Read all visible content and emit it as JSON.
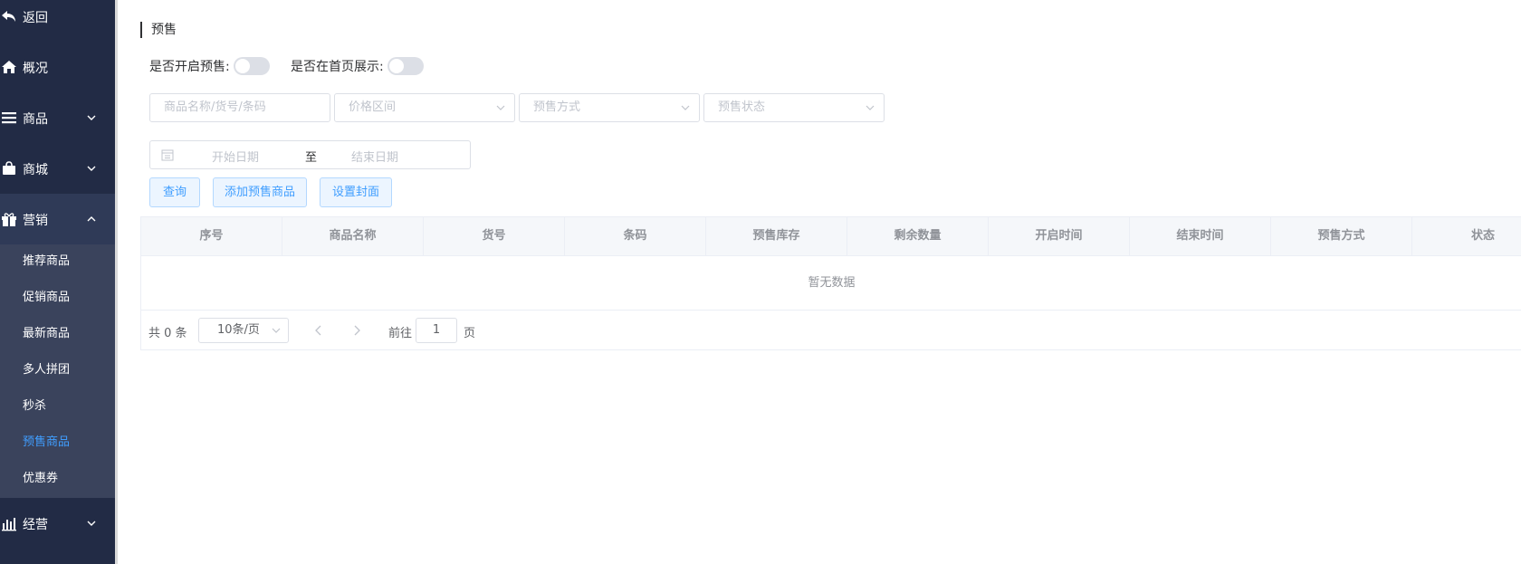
{
  "sidebar": {
    "items": [
      {
        "label": "返回",
        "icon": "back-arrow-icon"
      },
      {
        "label": "概况",
        "icon": "home-icon"
      },
      {
        "label": "商品",
        "icon": "list-icon"
      },
      {
        "label": "商城",
        "icon": "shopping-bag-icon"
      },
      {
        "label": "营销",
        "icon": "gift-icon"
      },
      {
        "label": "经营",
        "icon": "bar-chart-icon"
      }
    ],
    "submenu": [
      "推荐商品",
      "促销商品",
      "最新商品",
      "多人拼团",
      "秒杀",
      "预售商品",
      "优惠券"
    ],
    "active_color": "#409eff",
    "bg_color": "#222b45"
  },
  "page": {
    "title": "预售",
    "toggle_presale_label": "是否开启预售:",
    "toggle_homepage_label": "是否在首页展示:"
  },
  "filters": {
    "name_placeholder": "商品名称/货号/条码",
    "price_placeholder": "价格区间",
    "method_placeholder": "预售方式",
    "status_placeholder": "预售状态",
    "start_date_placeholder": "开始日期",
    "range_separator": "至",
    "end_date_placeholder": "结束日期"
  },
  "buttons": {
    "query": "查询",
    "add": "添加预售商品",
    "cover": "设置封面"
  },
  "table": {
    "columns": [
      "序号",
      "商品名称",
      "货号",
      "条码",
      "预售库存",
      "剩余数量",
      "开启时间",
      "结束时间",
      "预售方式",
      "状态"
    ],
    "empty_text": "暂无数据"
  },
  "pagination": {
    "total": "共 0 条",
    "page_size": "10条/页",
    "goto_label": "前往",
    "page": "1",
    "page_unit": "页"
  }
}
